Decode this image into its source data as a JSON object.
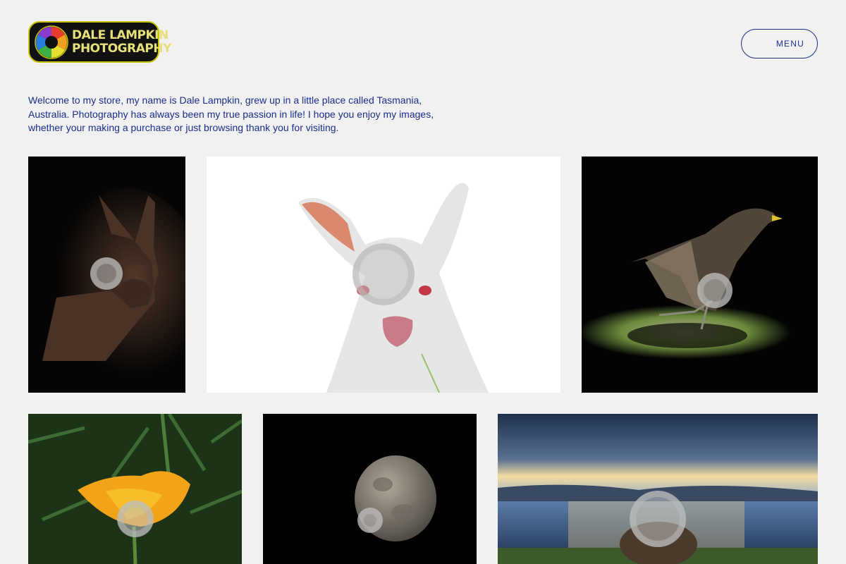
{
  "logo": {
    "line1": "DALE LAMPKIN",
    "line2": "PHOTOGRAPHY"
  },
  "header": {
    "menu_label": "MENU"
  },
  "intro": {
    "text": "Welcome to my store, my name is Dale Lampkin, grew up in a little place called Tasmania, Australia. Photography has always been my true passion in life! I hope you enjoy my images, whether your making a purchase or just browsing thank you for visiting."
  },
  "colors": {
    "accent": "#1a2e8a",
    "background": "#f1f1f1",
    "logo_gold": "#e6e07a"
  },
  "gallery": {
    "items": [
      {
        "subject": "wallaby-photo"
      },
      {
        "subject": "white-wallaby-photo"
      },
      {
        "subject": "native-hen-photo"
      },
      {
        "subject": "orange-poppy-photo"
      },
      {
        "subject": "moon-photo"
      },
      {
        "subject": "wombat-lake-sunset-photo"
      }
    ]
  }
}
